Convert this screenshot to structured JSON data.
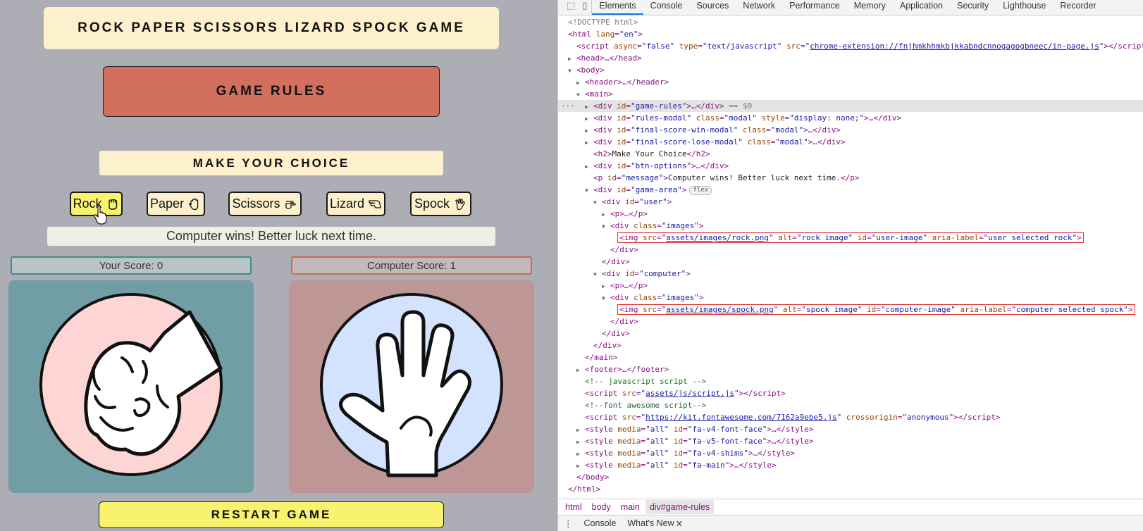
{
  "game": {
    "title": "ROCK PAPER SCISSORS LIZARD SPOCK GAME",
    "rules_button": "GAME RULES",
    "make_choice": "MAKE YOUR CHOICE",
    "options": [
      {
        "label": "Rock",
        "icon": "hand-rock-icon",
        "selected": true
      },
      {
        "label": "Paper",
        "icon": "hand-paper-icon",
        "selected": false
      },
      {
        "label": "Scissors",
        "icon": "hand-scissors-icon",
        "selected": false
      },
      {
        "label": "Lizard",
        "icon": "hand-lizard-icon",
        "selected": false
      },
      {
        "label": "Spock",
        "icon": "hand-spock-icon",
        "selected": false
      }
    ],
    "message": "Computer wins! Better luck next time.",
    "user_score": "Your Score: 0",
    "computer_score": "Computer Score: 1",
    "user_choice_image": "rock image",
    "computer_choice_image": "spock image",
    "restart_button": "RESTART GAME",
    "colors": {
      "background": "#adadb6",
      "title_bg": "#fdf0cd",
      "rules_bg": "#d26f5f",
      "selected_bg": "#f7f36e",
      "user_panel": "#719ea4",
      "computer_panel": "#bf9696"
    }
  },
  "devtools": {
    "tabs": [
      "Elements",
      "Console",
      "Sources",
      "Network",
      "Performance",
      "Memory",
      "Application",
      "Security",
      "Lighthouse",
      "Recorder"
    ],
    "active_tab": "Elements",
    "dom": {
      "doctype": "<!DOCTYPE html>",
      "script_src": "chrome-extension://fnjhmkhhmkbjkkabndcnnogagogbneec/in-page.js",
      "selected_suffix": "== $0",
      "message_text": "Computer wins! Better luck next time.",
      "h2_text": "Make Your Choice",
      "rock_src": "assets/images/rock.png",
      "spock_src": "assets/images/spock.png",
      "js_comment": "<!-- javascript script -->",
      "js_src": "assets/js/script.js",
      "fa_comment": "<!--font awesome script-->",
      "fa_src": "https://kit.fontawesome.com/7162a9ebe5.js",
      "flex_badge": "flex"
    },
    "breadcrumbs": [
      "html",
      "body",
      "main",
      "div#game-rules"
    ],
    "drawer_tabs": [
      "Console",
      "What's New"
    ]
  }
}
